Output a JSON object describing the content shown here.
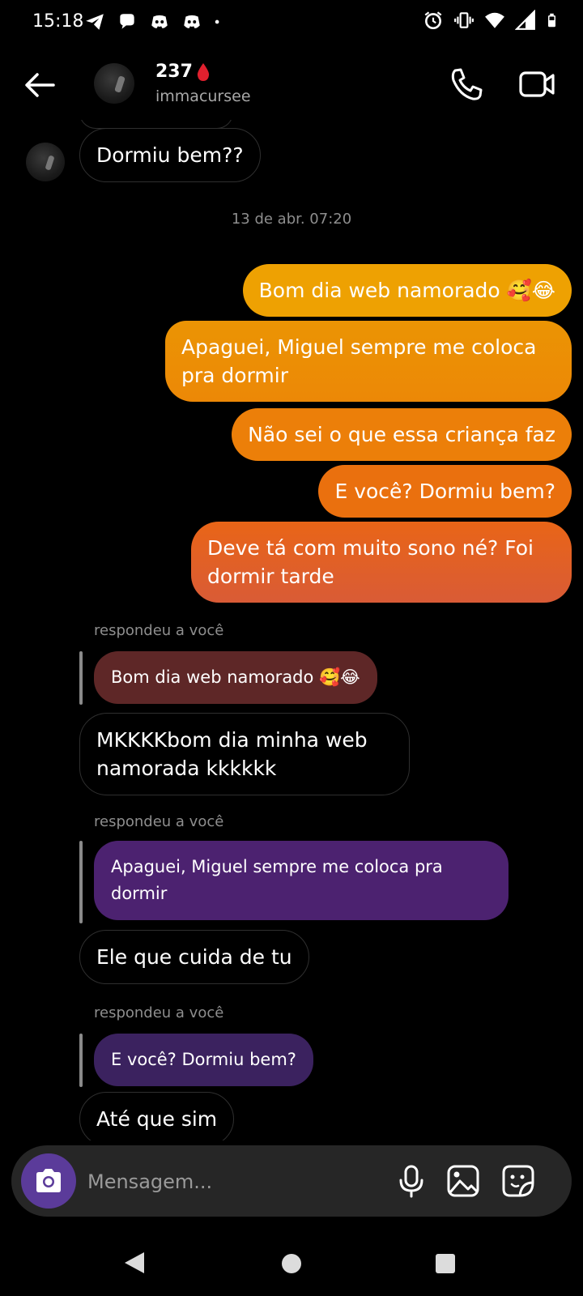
{
  "status_bar": {
    "time": "15:18",
    "left_icons": [
      "telegram-icon",
      "chat-icon",
      "discord-icon",
      "discord-icon",
      "dot-icon"
    ],
    "right_icons": [
      "alarm-icon",
      "vibrate-icon",
      "wifi-icon",
      "signal-icon",
      "battery-icon"
    ]
  },
  "header": {
    "name": "237",
    "name_emoji": "blood-drop",
    "username": "immacursee"
  },
  "chat": {
    "messages_top": {
      "incoming": "Dormiu bem??"
    },
    "timestamp": "13 de abr. 07:20",
    "outgoing": [
      "Bom dia web namorado 🥰😂",
      "Apaguei, Miguel sempre me coloca pra dormir",
      "Não sei o que essa criança faz",
      "E você? Dormiu bem?",
      "Deve tá com muito sono né? Foi dormir tarde"
    ],
    "replies": [
      {
        "label": "respondeu a você",
        "quoted": "Bom dia web namorado 🥰😂",
        "reply": "MKKKKbom dia minha web namorada kkkkkk"
      },
      {
        "label": "respondeu a você",
        "quoted": "Apaguei, Miguel sempre me coloca pra dormir",
        "reply": "Ele que cuida de tu"
      },
      {
        "label": "respondeu a você",
        "quoted": "E você? Dormiu bem?",
        "reply": "Até que sim"
      }
    ]
  },
  "composer": {
    "placeholder": "Mensagem...",
    "icons": [
      "camera-icon",
      "microphone-icon",
      "gallery-icon",
      "sticker-icon"
    ]
  },
  "colors": {
    "background": "#000000",
    "outgoing_gradient_top": "#F0A000",
    "outgoing_gradient_bottom": "#DA5A38",
    "quoted_brown": "#5E2727",
    "quoted_purple": "#4C2270",
    "camera_button": "#5B3B9A"
  }
}
